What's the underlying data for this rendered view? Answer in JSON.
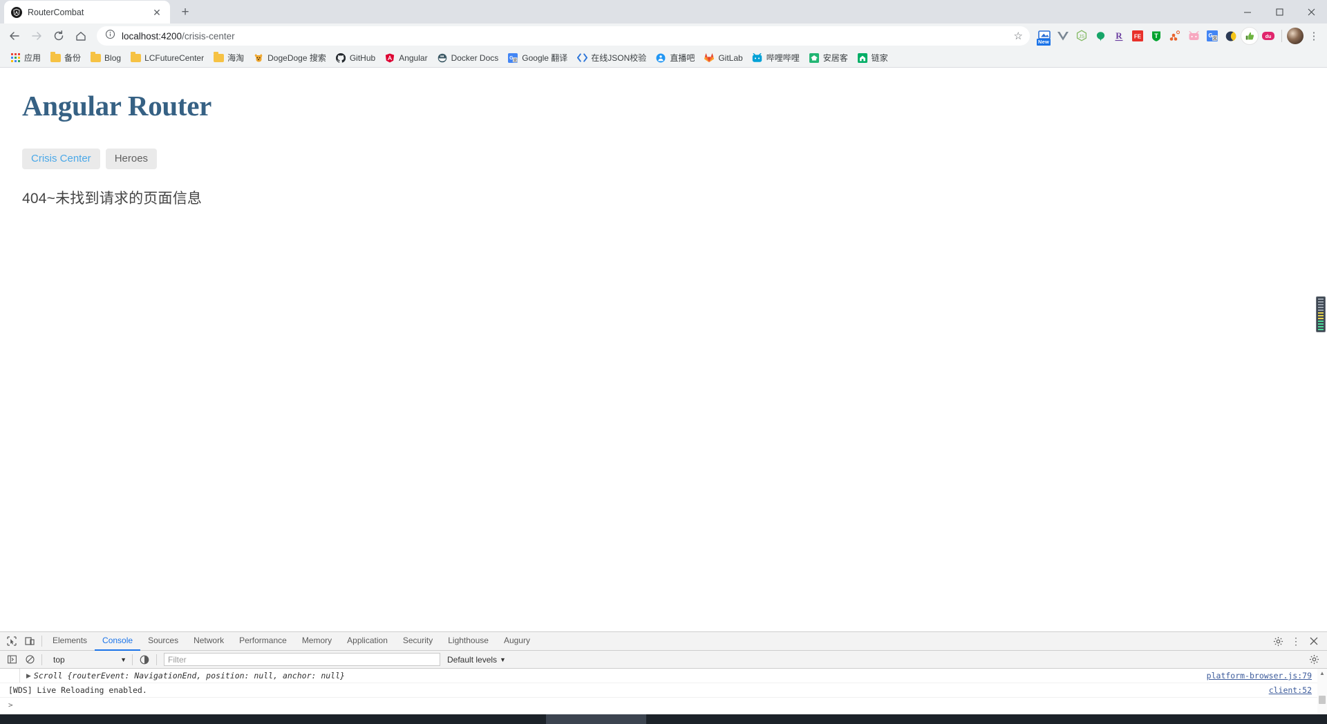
{
  "browser": {
    "tab": {
      "title": "RouterCombat",
      "favicon": "angular-icon",
      "close": "✕"
    },
    "new_tab_label": "+",
    "window_controls": {
      "minimize": "—",
      "maximize": "▢",
      "close": "✕"
    },
    "nav": {
      "back": "←",
      "forward": "→",
      "reload": "⟳",
      "home": "⌂"
    },
    "omnibox": {
      "info_icon": "info-circle-icon",
      "host": "localhost:4200",
      "path": "/crisis-center",
      "full_url": "localhost:4200/crisis-center",
      "star": "☆"
    },
    "extensions": [
      {
        "name": "screenshot-extension",
        "glyph": "⬓",
        "color": "#2a6fd6",
        "badge": "New"
      },
      {
        "name": "vue-devtools-extension",
        "glyph": "V",
        "color": "#7a8794"
      },
      {
        "name": "nodejs-extension",
        "glyph": "JS",
        "color": "#83ba63"
      },
      {
        "name": "green-drop-extension",
        "glyph": "●",
        "color": "#17a568"
      },
      {
        "name": "r-letter-extension",
        "glyph": "R",
        "color": "#6b3fa0"
      },
      {
        "name": "fe-helper-extension",
        "glyph": "FE",
        "color": "#e8312a"
      },
      {
        "name": "tampermonkey-extension",
        "glyph": "T",
        "color": "#00a32e"
      },
      {
        "name": "node-graph-extension",
        "glyph": "⁂",
        "color": "#e8622c"
      },
      {
        "name": "tv-pink-extension",
        "glyph": "▣",
        "color": "#f7a8c0"
      },
      {
        "name": "google-translate-extension",
        "glyph": "G",
        "color": "#4285f4"
      },
      {
        "name": "dark-mode-extension",
        "glyph": "☾",
        "color": "#f5c518"
      },
      {
        "name": "thumbs-up-extension",
        "glyph": "👍",
        "color": "#6db33f"
      },
      {
        "name": "du-extension",
        "glyph": "du",
        "color": "#e0256c"
      }
    ],
    "profile_avatar": "user-avatar",
    "menu": "⋮",
    "bookmarks": [
      {
        "label": "应用",
        "icon": "apps-grid-icon"
      },
      {
        "label": "备份",
        "icon": "folder-icon"
      },
      {
        "label": "Blog",
        "icon": "folder-icon"
      },
      {
        "label": "LCFutureCenter",
        "icon": "folder-icon"
      },
      {
        "label": "海淘",
        "icon": "folder-icon"
      },
      {
        "label": "DogeDoge 搜索",
        "icon": "dogedoge-icon"
      },
      {
        "label": "GitHub",
        "icon": "github-icon"
      },
      {
        "label": "Angular",
        "icon": "angular-icon"
      },
      {
        "label": "Docker Docs",
        "icon": "docker-icon"
      },
      {
        "label": "Google 翻译",
        "icon": "google-translate-icon"
      },
      {
        "label": "在线JSON校验",
        "icon": "code-brackets-icon"
      },
      {
        "label": "直播吧",
        "icon": "zhibo8-icon"
      },
      {
        "label": "GitLab",
        "icon": "gitlab-icon"
      },
      {
        "label": "哔哩哔哩",
        "icon": "bilibili-icon"
      },
      {
        "label": "安居客",
        "icon": "anjuke-icon"
      },
      {
        "label": "链家",
        "icon": "lianjia-icon"
      }
    ]
  },
  "page": {
    "heading": "Angular Router",
    "nav_links": [
      {
        "label": "Crisis Center",
        "state": "active"
      },
      {
        "label": "Heroes",
        "state": "inactive"
      }
    ],
    "message": "404~未找到请求的页面信息"
  },
  "devtools": {
    "inspect_icon": "inspect-element-icon",
    "device_icon": "device-toolbar-icon",
    "tabs": [
      {
        "label": "Elements",
        "active": false
      },
      {
        "label": "Console",
        "active": true
      },
      {
        "label": "Sources",
        "active": false
      },
      {
        "label": "Network",
        "active": false
      },
      {
        "label": "Performance",
        "active": false
      },
      {
        "label": "Memory",
        "active": false
      },
      {
        "label": "Application",
        "active": false
      },
      {
        "label": "Security",
        "active": false
      },
      {
        "label": "Lighthouse",
        "active": false
      },
      {
        "label": "Augury",
        "active": false
      }
    ],
    "settings_icon": "gear-icon",
    "more_icon": "kebab-menu-icon",
    "close_icon": "close-icon",
    "console_toolbar": {
      "sidebar_icon": "console-sidebar-icon",
      "clear_icon": "clear-console-icon",
      "context": "top",
      "context_caret": "▼",
      "eye_icon": "live-expression-icon",
      "filter_placeholder": "Filter",
      "filter_value": "",
      "levels_label": "Default levels",
      "levels_caret": "▼",
      "settings_icon": "gear-icon"
    },
    "logs": [
      {
        "expand": "▶",
        "text": "Scroll {routerEvent: NavigationEnd, position: null, anchor: null}",
        "source": "platform-browser.js:79",
        "italic": true,
        "grouped": true
      },
      {
        "expand": "",
        "text": "[WDS] Live Reloading enabled.",
        "source": "client:52",
        "italic": false,
        "grouped": false
      }
    ],
    "prompt": ">"
  },
  "taskbar": {
    "clock": ""
  },
  "colors": {
    "accent": "#1a73e8",
    "heading": "#366184",
    "link": "#4aa8e8",
    "chrome_bg": "#dee1e6",
    "toolbar_bg": "#f1f3f4"
  }
}
